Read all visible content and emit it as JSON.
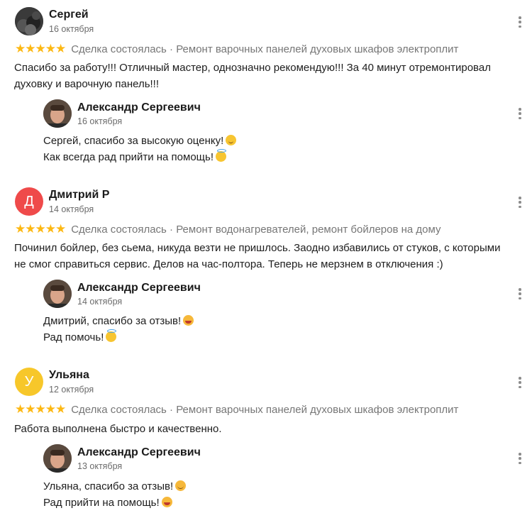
{
  "reviews": [
    {
      "author": "Сергей",
      "date": "16 октября",
      "avatar_letter": "",
      "stars": "★★★★★",
      "meta": "Сделка состоялась · Ремонт варочных панелей духовых шкафов электроплит",
      "lines": [
        "Спасибо за работу!!! Отличный мастер, однозначно рекомендую!!! За 40 минут отремонтировал",
        "духовку и варочную панель!!!"
      ],
      "reply": {
        "author": "Александр Сергеевич",
        "date": "16 октября",
        "lines": [
          "Сергей, спасибо за высокую оценку!",
          "Как всегда рад прийти на помощь!"
        ]
      }
    },
    {
      "author": "Дмитрий Р",
      "date": "14 октября",
      "avatar_letter": "Д",
      "stars": "★★★★★",
      "meta": "Сделка состоялась · Ремонт водонагревателей, ремонт бойлеров на дому",
      "lines": [
        "Починил бойлер, без сьема, никуда везти не пришлось. Заодно избавились от стуков, с которыми",
        "не смог справиться сервис. Делов на час-полтора. Теперь не мерзнем в отключения :)"
      ],
      "reply": {
        "author": "Александр Сергеевич",
        "date": "14 октября",
        "lines": [
          "Дмитрий, спасибо за отзыв!",
          "Рад помочь!"
        ]
      }
    },
    {
      "author": "Ульяна",
      "date": "12 октября",
      "avatar_letter": "У",
      "stars": "★★★★★",
      "meta": "Сделка состоялась · Ремонт варочных панелей духовых шкафов электроплит",
      "lines": [
        "Работа выполнена быстро и качественно."
      ],
      "reply": {
        "author": "Александр Сергеевич",
        "date": "13 октября",
        "lines": [
          "Ульяна, спасибо за отзыв!",
          "Рад прийти на помощь!"
        ]
      }
    }
  ],
  "colors": {
    "avatar_d": "#ef4a4a",
    "avatar_u": "#f7c72a",
    "stars": "#fdb813"
  },
  "icons": {
    "more": "more-vertical-icon",
    "star": "star-icon"
  }
}
